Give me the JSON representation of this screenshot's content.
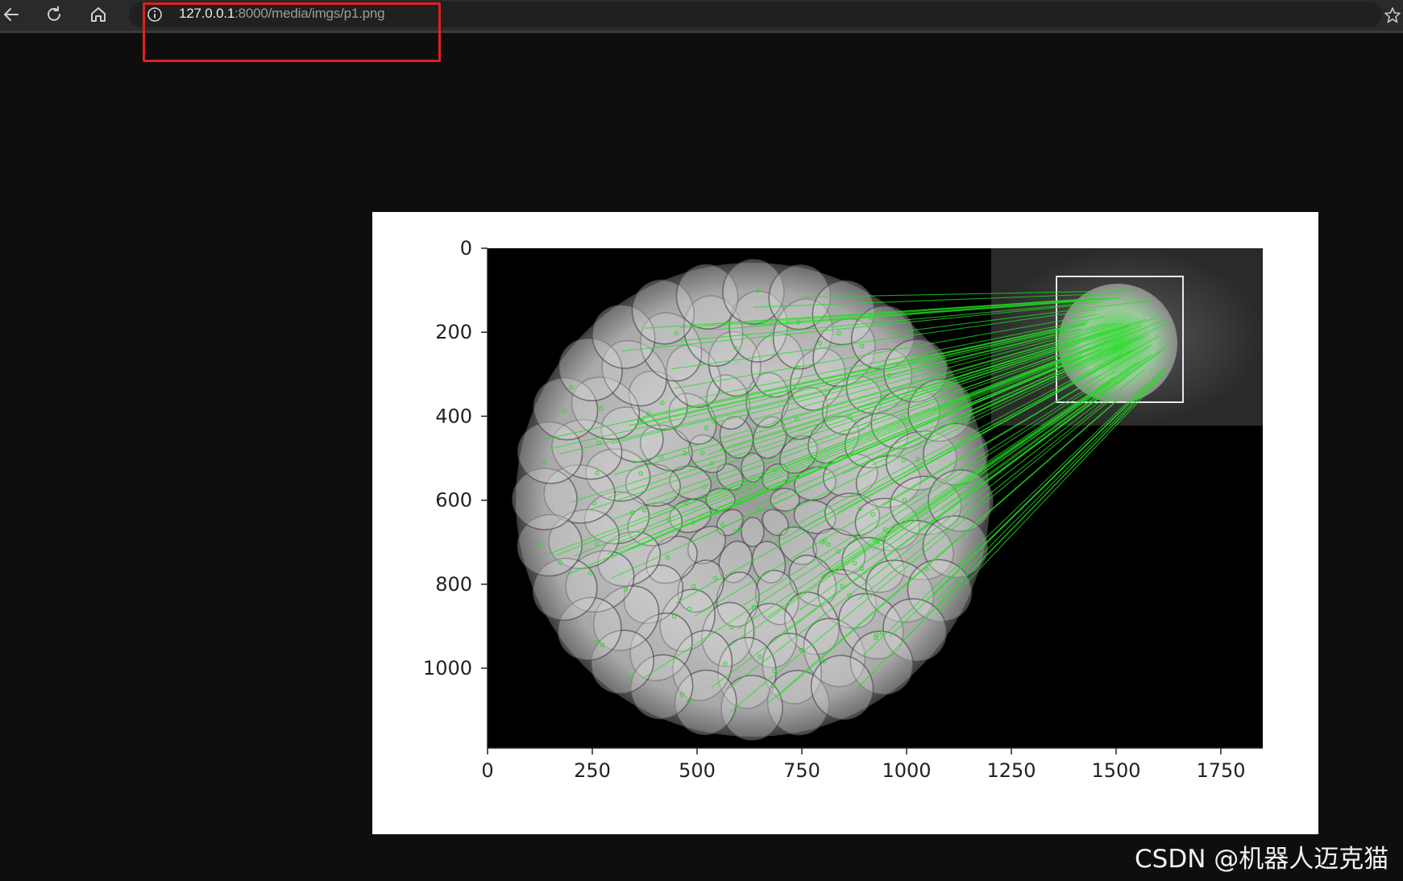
{
  "browser": {
    "url_host": "127.0.0.1",
    "url_rest": ":8000/media/imgs/p1.png",
    "icons": {
      "back": "back-arrow-icon",
      "reload": "reload-icon",
      "home": "home-icon",
      "info": "info-icon",
      "favorite": "star-icon"
    },
    "highlight_color": "#e02020"
  },
  "chart_data": {
    "type": "image",
    "x_ticks": [
      0,
      250,
      500,
      750,
      1000,
      1250,
      1500,
      1750
    ],
    "y_ticks": [
      0,
      200,
      400,
      600,
      800,
      1000
    ],
    "xlim": [
      0,
      1850
    ],
    "ylim": [
      1190,
      0
    ],
    "match_line_color": "#22dd22"
  },
  "watermark": "CSDN @机器人迈克猫"
}
